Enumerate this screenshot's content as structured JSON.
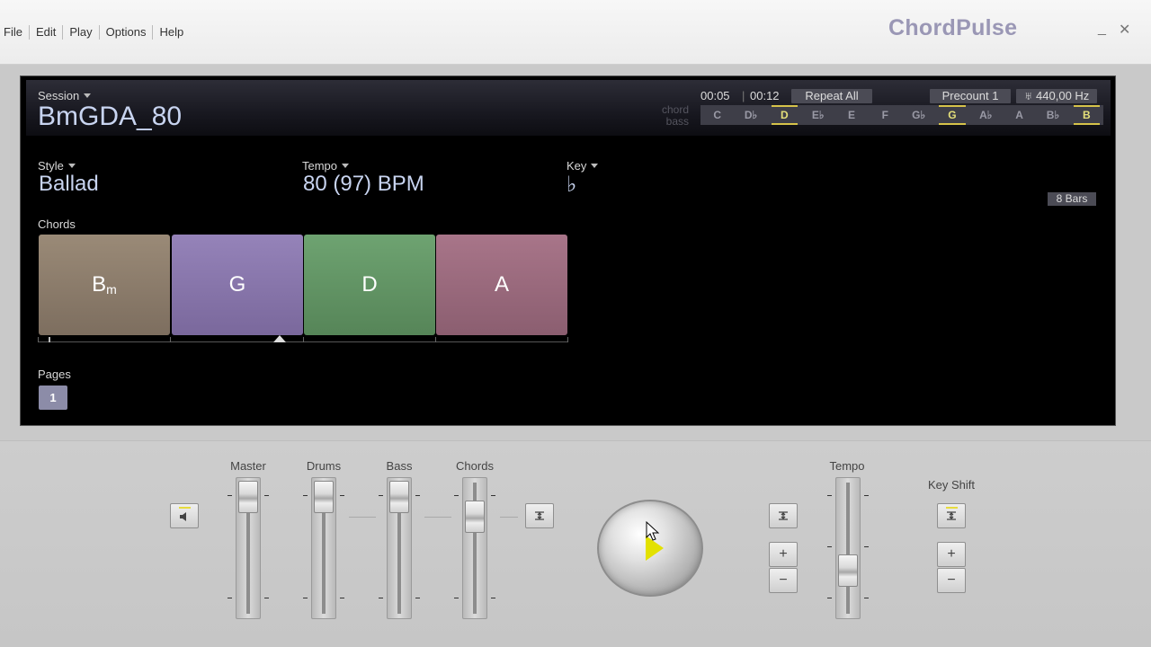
{
  "menu": [
    "File",
    "Edit",
    "Play",
    "Options",
    "Help"
  ],
  "app_title": "ChordPulse",
  "window_controls": {
    "minimize": "_",
    "close": "✕"
  },
  "session": {
    "label": "Session",
    "name": "BmGDA_80"
  },
  "transport": {
    "elapsed": "00:05",
    "total": "00:12",
    "repeat": "Repeat All",
    "precount": "Precount 1",
    "tuning": "♅ 440,00 Hz"
  },
  "chord_bass_label": {
    "chord": "chord",
    "bass": "bass"
  },
  "keys": [
    {
      "name": "C",
      "active": false
    },
    {
      "name": "D♭",
      "active": false
    },
    {
      "name": "D",
      "active": true
    },
    {
      "name": "E♭",
      "active": false
    },
    {
      "name": "E",
      "active": false
    },
    {
      "name": "F",
      "active": false
    },
    {
      "name": "G♭",
      "active": false
    },
    {
      "name": "G",
      "active": true
    },
    {
      "name": "A♭",
      "active": false
    },
    {
      "name": "A",
      "active": false
    },
    {
      "name": "B♭",
      "active": false
    },
    {
      "name": "B",
      "active": true
    }
  ],
  "style": {
    "label": "Style",
    "value": "Ballad"
  },
  "tempo": {
    "label": "Tempo",
    "value": "80 (97) BPM"
  },
  "key": {
    "label": "Key",
    "value": "♭"
  },
  "bars": "8 Bars",
  "chords": {
    "label": "Chords",
    "items": [
      {
        "root": "B",
        "quality": "m",
        "color": "#8f7f6d"
      },
      {
        "root": "G",
        "quality": "",
        "color": "#8a77ad"
      },
      {
        "root": "D",
        "quality": "",
        "color": "#5f9262"
      },
      {
        "root": "A",
        "quality": "",
        "color": "#9a6a7d"
      }
    ]
  },
  "pages": {
    "label": "Pages",
    "current": "1"
  },
  "mixer": {
    "channels": [
      {
        "name": "Master",
        "level": 0.95
      },
      {
        "name": "Drums",
        "level": 0.95
      },
      {
        "name": "Bass",
        "level": 0.95
      },
      {
        "name": "Chords",
        "level": 0.78
      }
    ],
    "tempo": {
      "label": "Tempo",
      "level": 0.2
    },
    "key_shift": {
      "label": "Key Shift"
    },
    "plus": "+",
    "minus": "−",
    "speaker_icon": "speaker-icon",
    "lock_icon": "lock-sync-icon"
  },
  "colors": {
    "accent": "#d6c34a",
    "panel_bg": "#000000",
    "text_value": "#c8d4f0"
  }
}
